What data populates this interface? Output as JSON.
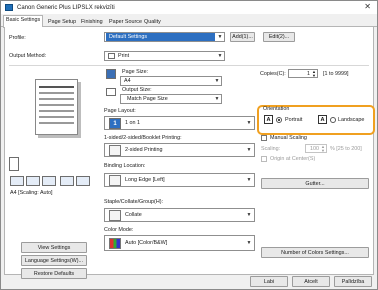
{
  "window": {
    "title": "Canon Generic Plus LIPSLX rekvizīti",
    "close_glyph": "✕"
  },
  "tabs": [
    "Basic Settings",
    "Page Setup",
    "Finishing",
    "Paper Source",
    "Quality"
  ],
  "active_tab": "Basic Settings",
  "profile": {
    "label": "Profile:",
    "value": "Default Settings",
    "add_label": "Add(1)...",
    "edit_label": "Edit(2)..."
  },
  "output_method": {
    "label": "Output Method:",
    "value": "Print"
  },
  "page_size": {
    "label": "Page Size:",
    "value": "A4"
  },
  "output_size": {
    "label": "Output Size:",
    "value": "Match Page Size"
  },
  "page_layout": {
    "label": "Page Layout:",
    "value": "1 on 1",
    "badge": "1"
  },
  "printing": {
    "label": "1-sided/2-sided/Booklet Printing:",
    "value": "2-sided Printing"
  },
  "binding": {
    "label": "Binding Location:",
    "value": "Long Edge [Left]",
    "gutter_label": "Gutter..."
  },
  "staple": {
    "label": "Staple/Collate/Group(H):",
    "value": "Collate"
  },
  "color_mode": {
    "label": "Color Mode:",
    "value": "Auto [Color/B&W]",
    "number_of_colors_label": "Number of Colors Settings..."
  },
  "copies": {
    "label": "Copies(C):",
    "value": "1",
    "range": "[1 to 9999]"
  },
  "orientation": {
    "label": "Orientation",
    "portrait": "Portrait",
    "landscape": "Landscape",
    "selected": "Portrait"
  },
  "manual_scaling": {
    "label": "Manual Scaling"
  },
  "scaling": {
    "label": "Scaling:",
    "value": "100",
    "range": "% [25 to 200]"
  },
  "origin_at_center": {
    "label": "Origin at Center(S)"
  },
  "preview": {
    "caption": "A4 [Scaling: Auto]"
  },
  "left_buttons": {
    "view_settings": "View Settings",
    "language_settings": "Language Settings(W)...",
    "restore_defaults": "Restore Defaults"
  },
  "bottom_buttons": {
    "ok": "Labi",
    "cancel": "Atcelt",
    "help": "Palīdzība"
  },
  "colors": {
    "accent": "#2d6fc1",
    "highlight": "#f0a020"
  }
}
